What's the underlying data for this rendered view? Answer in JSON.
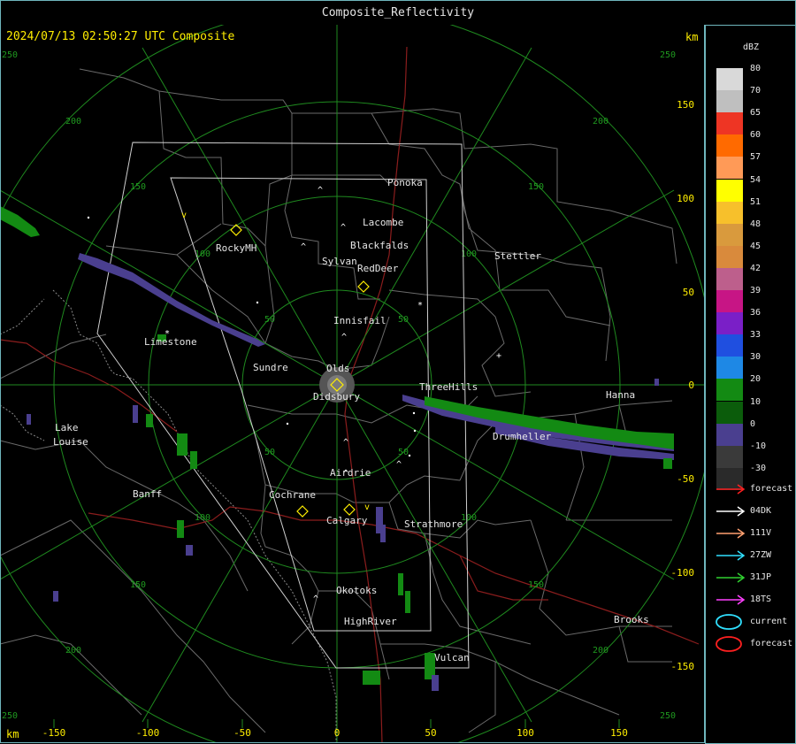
{
  "window": {
    "title": "Composite_Reflectivity"
  },
  "timestamp": "2024/07/13 02:50:27 UTC Composite",
  "axis": {
    "unit_top": "km",
    "unit_bottom": "km",
    "x_ticks": [
      "-150",
      "-100",
      "-50",
      "0",
      "50",
      "100",
      "150"
    ],
    "y_ticks": [
      "150",
      "100",
      "50",
      "0",
      "-50",
      "-100",
      "-150"
    ],
    "corner_labels": [
      "250",
      "250",
      "250",
      "250"
    ]
  },
  "rings": {
    "labels": [
      "50",
      "50",
      "50",
      "50",
      "100",
      "100",
      "100",
      "100",
      "150",
      "150",
      "150",
      "150",
      "200",
      "200",
      "200",
      "200"
    ]
  },
  "cities": [
    "Ponoka",
    "Lacombe",
    "Blackfalds",
    "RockyMH",
    "Sylvan",
    "RedDeer",
    "Stettler",
    "Innisfail",
    "Limestone",
    "Sundre",
    "Olds",
    "Didsbury",
    "ThreeHills",
    "Hanna",
    "Drumheller",
    "Lake",
    "Louise",
    "Banff",
    "Airdrie",
    "Cochrane",
    "Calgary",
    "Strathmore",
    "Okotoks",
    "HighRiver",
    "Vulcan",
    "Brooks"
  ],
  "legend": {
    "title": "dBZ",
    "levels": [
      "80",
      "70",
      "65",
      "60",
      "57",
      "54",
      "51",
      "48",
      "45",
      "42",
      "39",
      "36",
      "33",
      "30",
      "20",
      "10",
      "0",
      "-10",
      "-30"
    ],
    "colors": [
      "#d9d9d9",
      "#bfbfbf",
      "#ee3524",
      "#ff6a00",
      "#ff9a57",
      "#ffff00",
      "#f7c02b",
      "#d99a3d",
      "#d98a3c",
      "#bd5f8c",
      "#c71585",
      "#7a1fc7",
      "#1f4fe0",
      "#1e88e5",
      "#138a13",
      "#0b5c0b",
      "#4a3f8f",
      "#3a3a3a",
      "#2a2a2a"
    ],
    "tracks": [
      {
        "label": "forecast",
        "color": "#ff2020"
      },
      {
        "label": "04DK",
        "color": "#ffffff"
      },
      {
        "label": "111V",
        "color": "#ffa070"
      },
      {
        "label": "27ZW",
        "color": "#30e0ff"
      },
      {
        "label": "31JP",
        "color": "#30d030"
      },
      {
        "label": "18TS",
        "color": "#ff40ff"
      }
    ],
    "cells": [
      {
        "label": "current",
        "color": "#30e0ff"
      },
      {
        "label": "forecast",
        "color": "#ff2020"
      }
    ]
  }
}
